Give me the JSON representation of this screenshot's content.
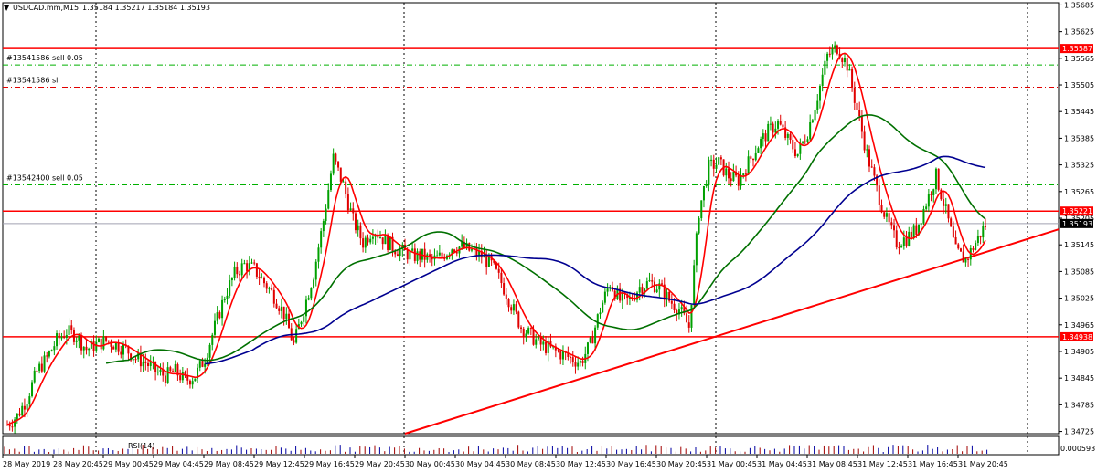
{
  "header": {
    "symbol_title": "USDCAD.mm,M15",
    "ohlc": "1.35184 1.35217 1.35184 1.35193"
  },
  "chart_data": {
    "type": "candlestick",
    "symbol": "USDCAD.mm",
    "timeframe": "M15",
    "ylim": [
      1.3472,
      1.3569
    ],
    "y_ticks": [
      "1.35685",
      "1.35625",
      "1.35565",
      "1.35505",
      "1.35445",
      "1.35385",
      "1.35325",
      "1.35265",
      "1.35205",
      "1.35145",
      "1.35085",
      "1.35025",
      "1.34965",
      "1.34905",
      "1.34845",
      "1.34785",
      "1.34725"
    ],
    "x_ticks": [
      "28 May 2019",
      "28 May 20:45",
      "29 May 00:45",
      "29 May 04:45",
      "29 May 08:45",
      "29 May 12:45",
      "29 May 16:45",
      "29 May 20:45",
      "30 May 00:45",
      "30 May 04:45",
      "30 May 08:45",
      "30 May 12:45",
      "30 May 16:45",
      "30 May 20:45",
      "31 May 00:45",
      "31 May 04:45",
      "31 May 08:45",
      "31 May 12:45",
      "31 May 16:45",
      "31 May 20:45"
    ],
    "price_levels": [
      {
        "name": "resistance",
        "value": 1.35587,
        "label": "1.35587",
        "color": "#ff0000",
        "style": "solid"
      },
      {
        "name": "level-2",
        "value": 1.35221,
        "label": "1.35221",
        "color": "#ff0000",
        "style": "solid"
      },
      {
        "name": "bid",
        "value": 1.35193,
        "label": "1.35193",
        "color": "#a0a0b0",
        "style": "solid"
      },
      {
        "name": "support",
        "value": 1.34938,
        "label": "1.34938",
        "color": "#ff0000",
        "style": "solid"
      }
    ],
    "order_lines": [
      {
        "label": "#13541586 sell 0.05",
        "value": 1.3555,
        "color": "#00b000"
      },
      {
        "label": "#13541586 sl",
        "value": 1.355,
        "color": "#e00000"
      },
      {
        "label": "#13542400 sell 0.05",
        "value": 1.3528,
        "color": "#00b000"
      }
    ],
    "trendline": {
      "from": [
        "30 May 00:45",
        1.3472
      ],
      "to": [
        "31 May 20:45",
        1.3518
      ],
      "color": "#ff0000"
    },
    "closes": [
      1.3474,
      1.3476,
      1.348,
      1.3486,
      1.3489,
      1.3493,
      1.3495,
      1.3494,
      1.3491,
      1.3492,
      1.3493,
      1.3492,
      1.3491,
      1.3489,
      1.3488,
      1.3486,
      1.3485,
      1.3486,
      1.3484,
      1.3485,
      1.3489,
      1.3496,
      1.3503,
      1.3508,
      1.351,
      1.3509,
      1.3506,
      1.3503,
      1.3499,
      1.3492,
      1.35,
      1.3508,
      1.352,
      1.3534,
      1.3528,
      1.352,
      1.3515,
      1.3518,
      1.3516,
      1.3514,
      1.3513,
      1.3512,
      1.3512,
      1.3511,
      1.3512,
      1.3514,
      1.3514,
      1.3513,
      1.3512,
      1.351,
      1.3506,
      1.3501,
      1.3496,
      1.3494,
      1.3492,
      1.3491,
      1.349,
      1.3489,
      1.3488,
      1.3492,
      1.35,
      1.3506,
      1.3502,
      1.3502,
      1.3505,
      1.3506,
      1.3505,
      1.3502,
      1.35,
      1.3496,
      1.3522,
      1.3532,
      1.3533,
      1.353,
      1.3529,
      1.3533,
      1.3537,
      1.354,
      1.3542,
      1.3538,
      1.3535,
      1.354,
      1.3548,
      1.3557,
      1.3559,
      1.3555,
      1.3545,
      1.3535,
      1.3527,
      1.352,
      1.3515,
      1.3516,
      1.3518,
      1.3524,
      1.353,
      1.3522,
      1.3513,
      1.3511,
      1.3515,
      1.3519
    ],
    "ma_colors": {
      "fast": "#ff0000",
      "mid": "#007000",
      "slow": "#000090"
    },
    "indicator": {
      "label": "RSI(14)",
      "readout": "0.000593"
    }
  }
}
